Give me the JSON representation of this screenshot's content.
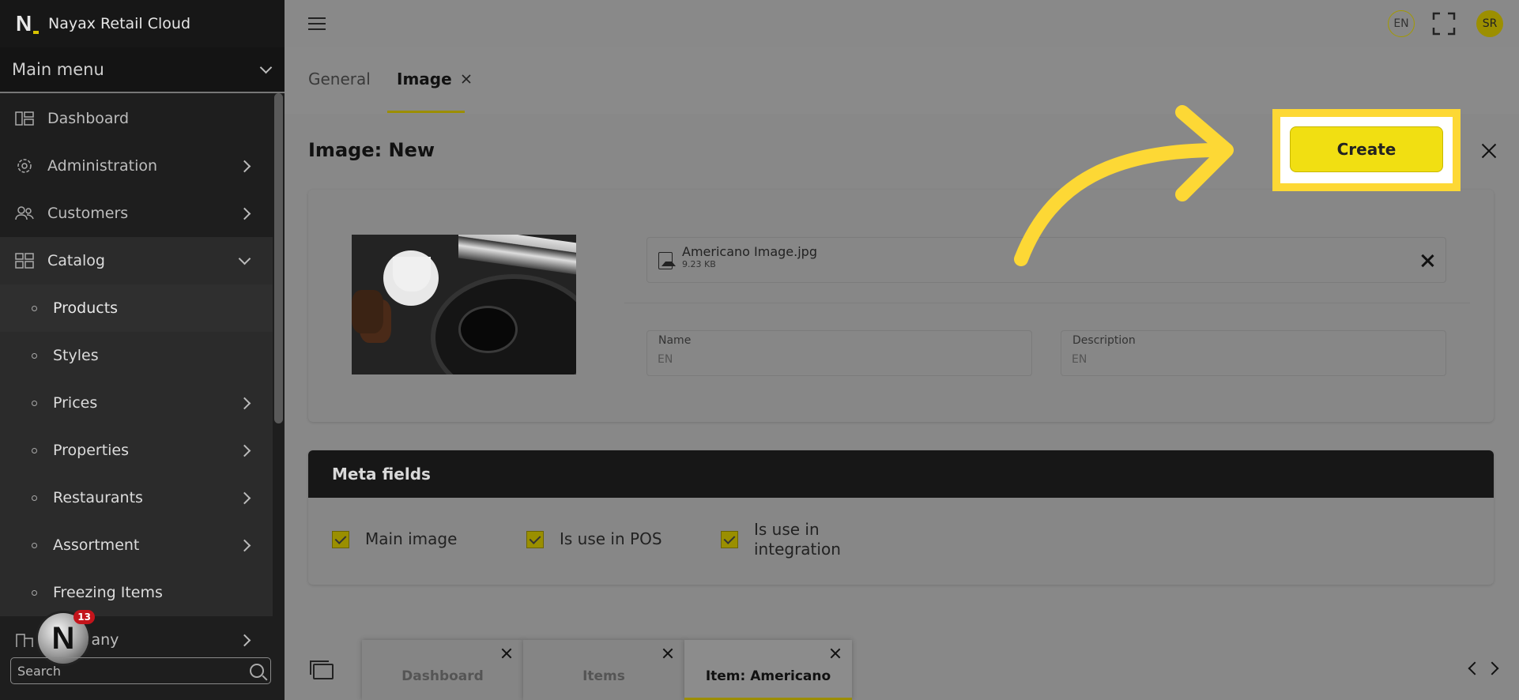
{
  "app": {
    "title": "Nayax Retail Cloud"
  },
  "sidebar": {
    "main_menu_label": "Main menu",
    "items": [
      {
        "label": "Dashboard"
      },
      {
        "label": "Administration"
      },
      {
        "label": "Customers"
      },
      {
        "label": "Catalog"
      }
    ],
    "sub_items": [
      {
        "label": "Products"
      },
      {
        "label": "Styles"
      },
      {
        "label": "Prices"
      },
      {
        "label": "Properties"
      },
      {
        "label": "Restaurants"
      },
      {
        "label": "Assortment"
      },
      {
        "label": "Freezing Items"
      },
      {
        "label": "Company"
      }
    ],
    "search_placeholder": "Search",
    "notification_count": "13"
  },
  "topbar": {
    "language": "EN",
    "user_initials": "SR"
  },
  "tabs": [
    {
      "label": "General"
    },
    {
      "label": "Image"
    }
  ],
  "page": {
    "title": "Image: New",
    "create_label": "Create"
  },
  "file": {
    "name": "Americano Image.jpg",
    "size": "9.23 KB"
  },
  "fields": {
    "name": {
      "label": "Name",
      "placeholder": "EN"
    },
    "description": {
      "label": "Description",
      "placeholder": "EN"
    }
  },
  "meta": {
    "title": "Meta fields",
    "checkboxes": [
      {
        "label": "Main image",
        "checked": true
      },
      {
        "label": "Is use in POS",
        "checked": true
      },
      {
        "label": "Is use in integration",
        "checked": true
      }
    ]
  },
  "bottom_tabs": [
    {
      "label": "Dashboard"
    },
    {
      "label": "Items"
    },
    {
      "label": "Item: Americano"
    }
  ],
  "colors": {
    "accent": "#f1df12",
    "highlight": "#fdd835",
    "sidebar": "#1e1e1e"
  }
}
